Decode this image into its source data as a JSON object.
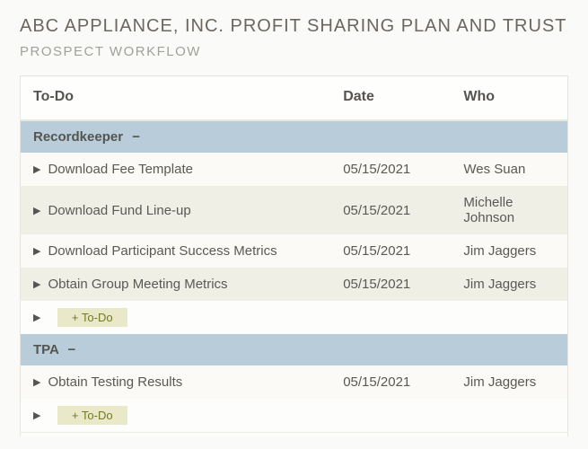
{
  "page_title": "ABC APPLIANCE, INC. PROFIT SHARING PLAN AND TRUST",
  "subtitle": "PROSPECT WORKFLOW",
  "columns": {
    "todo": "To-Do",
    "date": "Date",
    "who": "Who"
  },
  "sections": [
    {
      "name": "Recordkeeper",
      "items": [
        {
          "label": "Download Fee Template",
          "date": "05/15/2021",
          "who": "Wes Suan"
        },
        {
          "label": "Download Fund Line-up",
          "date": "05/15/2021",
          "who": "Michelle Johnson"
        },
        {
          "label": "Download Participant Success Metrics",
          "date": "05/15/2021",
          "who": "Jim Jaggers"
        },
        {
          "label": "Obtain Group Meeting Metrics",
          "date": "05/15/2021",
          "who": "Jim Jaggers"
        }
      ],
      "add_label": "+ To-Do"
    },
    {
      "name": "TPA",
      "items": [
        {
          "label": "Obtain Testing Results",
          "date": "05/15/2021",
          "who": "Jim Jaggers"
        }
      ],
      "add_label": "+ To-Do"
    }
  ]
}
